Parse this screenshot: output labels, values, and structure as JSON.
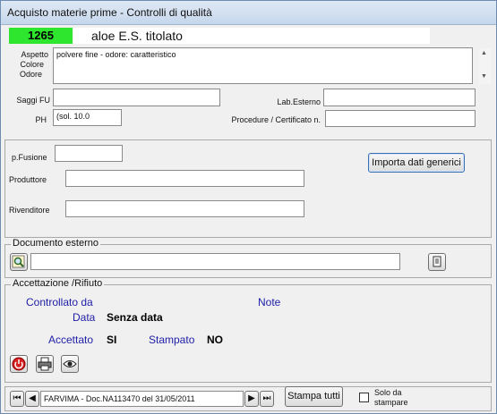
{
  "window": {
    "title": "Acquisto materie prime - Controlli di qualità"
  },
  "header": {
    "code": "1265",
    "product_name": "aloe E.S. titolato"
  },
  "details": {
    "appearance_label_1": "Aspetto",
    "appearance_label_2": "Colore",
    "appearance_label_3": "Odore",
    "appearance_value": "polvere fine - odore:  caratteristico",
    "saggi_label": "Saggi FU",
    "saggi_value": "",
    "lab_label": "Lab.Esterno",
    "lab_value": "",
    "ph_label": "PH",
    "ph_value": "(sol. 10.0",
    "procedure_label": "Procedure / Certificato n.",
    "procedure_value": ""
  },
  "supply": {
    "fusion_label": "p.Fusione",
    "fusion_value": "",
    "import_button": "Importa dati generici",
    "producer_label": "Produttore",
    "producer_value": "",
    "reseller_label": "Rivenditore",
    "reseller_value": ""
  },
  "external_doc": {
    "title": "Documento esterno",
    "path_value": ""
  },
  "acceptance": {
    "title": "Accettazione /Rifiuto",
    "checked_by_label": "Controllato da",
    "notes_label": "Note",
    "date_label": "Data",
    "date_value": "Senza data",
    "accepted_label": "Accettato",
    "accepted_value": "SI",
    "printed_label": "Stampato",
    "printed_value": "NO"
  },
  "footer": {
    "record_text": "FARVIMA - Doc.NA113470  del  31/05/2011",
    "print_all_button": "Stampa tutti",
    "only_to_print_label_1": "Solo da",
    "only_to_print_label_2": "stampare",
    "only_to_print_checked": false
  }
}
